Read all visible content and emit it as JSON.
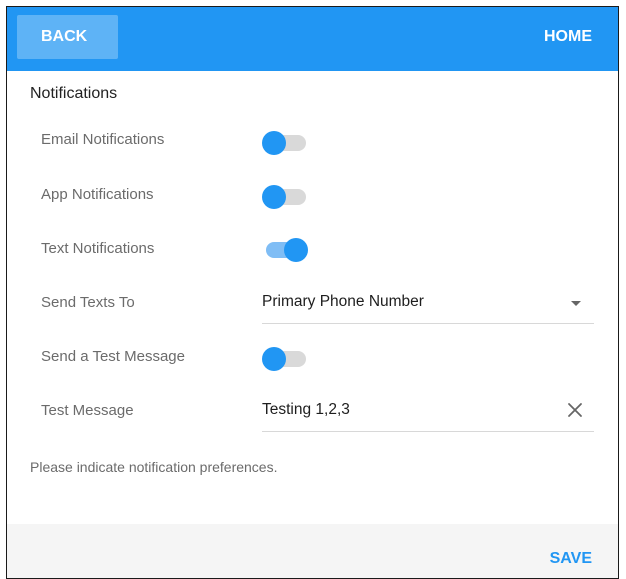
{
  "appbar": {
    "back_label": "BACK",
    "home_label": "HOME"
  },
  "section_title": "Notifications",
  "rows": {
    "email": {
      "label": "Email Notifications",
      "state": "off"
    },
    "app": {
      "label": "App Notifications",
      "state": "off"
    },
    "text": {
      "label": "Text Notifications",
      "state": "on"
    },
    "send_to": {
      "label": "Send Texts To",
      "value": "Primary Phone Number"
    },
    "test_toggle": {
      "label": "Send a Test Message",
      "state": "off"
    },
    "test_message": {
      "label": "Test Message",
      "value": "Testing 1,2,3"
    }
  },
  "helper_text": "Please indicate notification preferences.",
  "footer": {
    "save_label": "SAVE"
  },
  "colors": {
    "accent": "#2196f3",
    "track_on": "#7fbdf5",
    "track_off": "#d9d9d9"
  },
  "icons": [
    "chevron-down-icon",
    "close-icon"
  ]
}
